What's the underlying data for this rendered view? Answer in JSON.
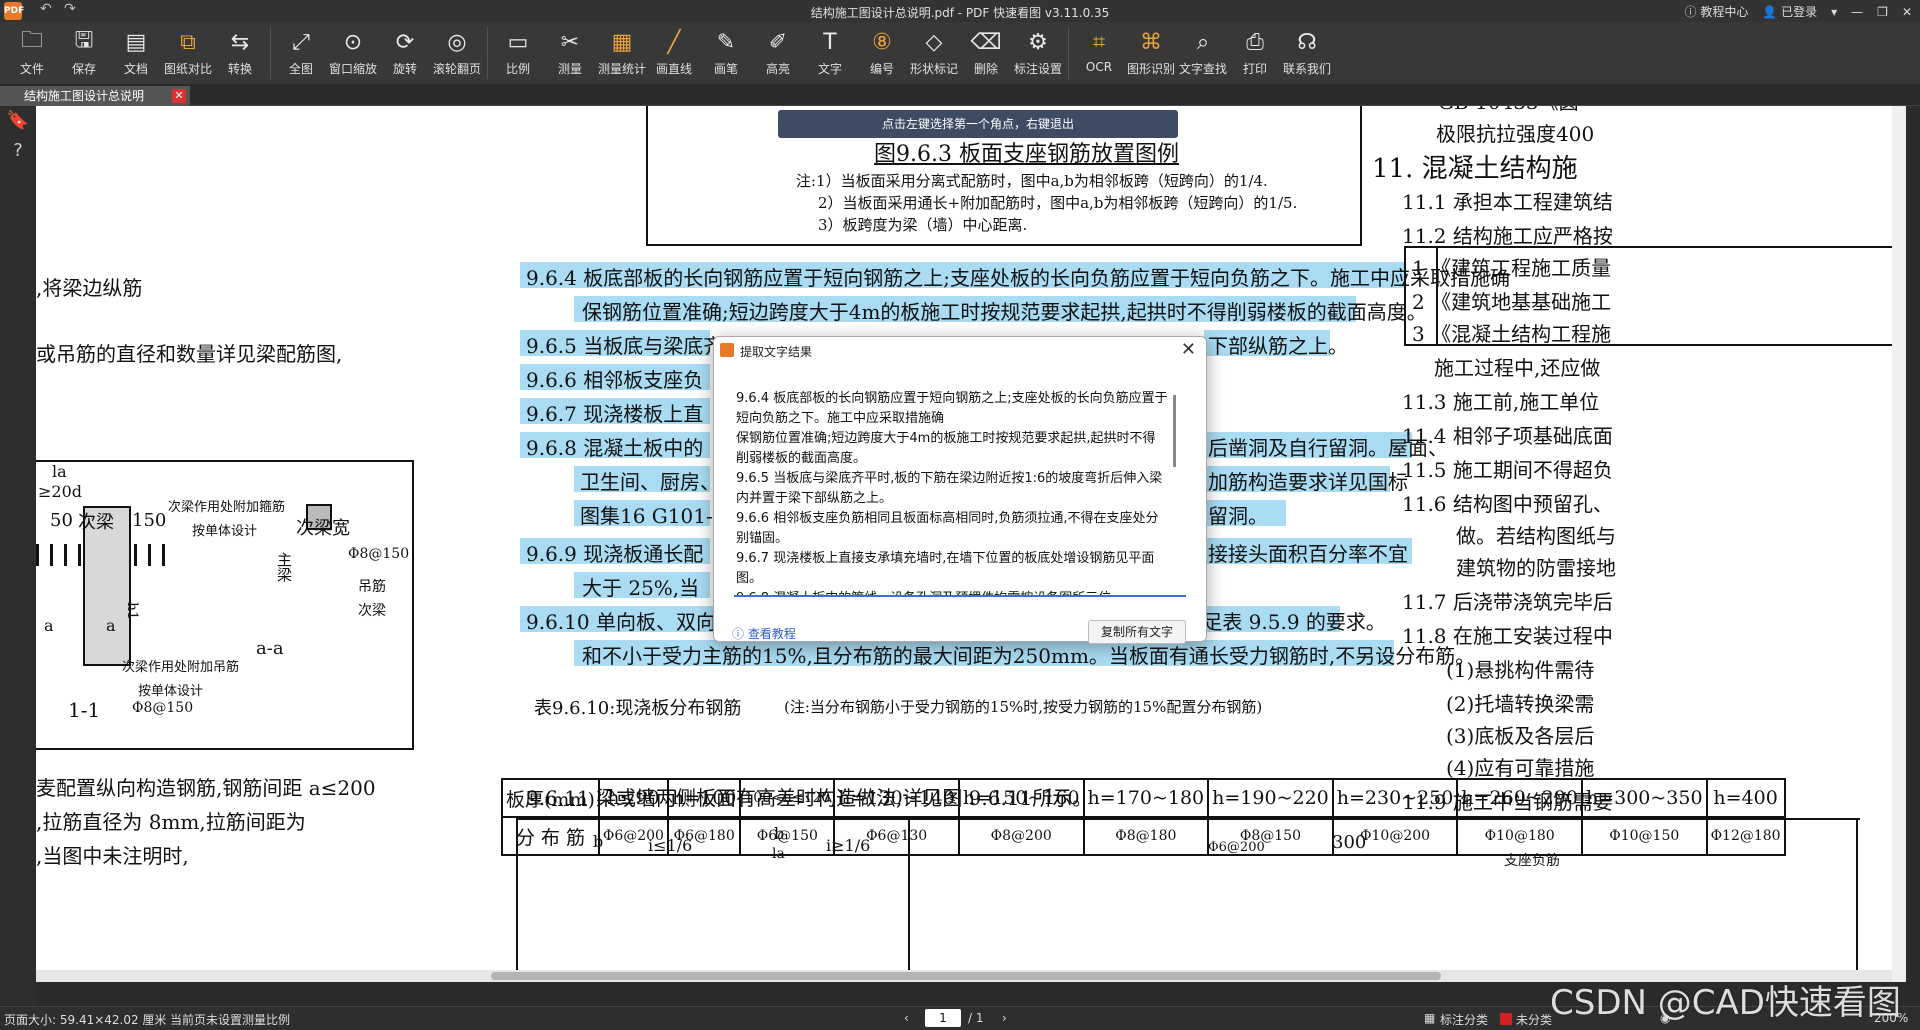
{
  "titlebar": {
    "logo": "PDF",
    "title": "结构施工图设计总说明.pdf - PDF 快速看图 v3.11.0.35",
    "help": "教程中心",
    "login": "已登录"
  },
  "toolbar": {
    "items": [
      {
        "label": "文件",
        "icon": "folder-icon",
        "glyph": "🗀"
      },
      {
        "label": "保存",
        "icon": "save-icon",
        "glyph": "🖫"
      },
      {
        "label": "文档",
        "icon": "document-icon",
        "glyph": "▤"
      },
      {
        "label": "图纸对比",
        "icon": "compare-icon",
        "glyph": "⧉"
      },
      {
        "label": "转换",
        "icon": "convert-icon",
        "glyph": "⇆"
      },
      {
        "label": "全图",
        "icon": "fit-all-icon",
        "glyph": "⤢"
      },
      {
        "label": "窗口缩放",
        "icon": "zoom-window-icon",
        "glyph": "⊙"
      },
      {
        "label": "旋转",
        "icon": "rotate-icon",
        "glyph": "⟳"
      },
      {
        "label": "滚轮翻页",
        "icon": "mouse-wheel-icon",
        "glyph": "◎"
      },
      {
        "label": "比例",
        "icon": "scale-icon",
        "glyph": "▭"
      },
      {
        "label": "测量",
        "icon": "measure-icon",
        "glyph": "✂"
      },
      {
        "label": "测量统计",
        "icon": "measure-stats-icon",
        "glyph": "▦"
      },
      {
        "label": "画直线",
        "icon": "line-icon",
        "glyph": "╱"
      },
      {
        "label": "画笔",
        "icon": "pen-icon",
        "glyph": "✎"
      },
      {
        "label": "高亮",
        "icon": "highlight-icon",
        "glyph": "✐"
      },
      {
        "label": "文字",
        "icon": "text-icon",
        "glyph": "T"
      },
      {
        "label": "编号",
        "icon": "number-icon",
        "glyph": "⑧"
      },
      {
        "label": "形状标记",
        "icon": "shape-mark-icon",
        "glyph": "◇"
      },
      {
        "label": "删除",
        "icon": "eraser-icon",
        "glyph": "⌫"
      },
      {
        "label": "标注设置",
        "icon": "annotation-settings-icon",
        "glyph": "⚙"
      },
      {
        "label": "OCR",
        "icon": "ocr-icon",
        "glyph": "⌗"
      },
      {
        "label": "图形识别",
        "icon": "shape-recognize-icon",
        "glyph": "⌘"
      },
      {
        "label": "文字查找",
        "icon": "search-icon",
        "glyph": "⌕"
      },
      {
        "label": "打印",
        "icon": "printer-icon",
        "glyph": "⎙"
      },
      {
        "label": "联系我们",
        "icon": "headset-icon",
        "glyph": "☊"
      }
    ]
  },
  "tab": {
    "label": "结构施工图设计总说明",
    "close": "✕"
  },
  "hint": "点击左键选择第一个角点，右键退出",
  "doc": {
    "fig_title": "图9.6.3  板面支座钢筋放置图例",
    "notes": [
      "注:1）当板面采用分离式配筋时，图中a,b为相邻板跨（短跨向）的1/4.",
      "2）当板面采用通长+附加配筋时，图中a,b为相邻板跨（短跨向）的1/5.",
      "3）板跨度为梁（墙）中心距离."
    ],
    "p964a": "9.6.4  板底部板的长向钢筋应置于短向钢筋之上;支座处板的长向负筋应置于短向负筋之下。施工中应采取措施确",
    "p964b": "保钢筋位置准确;短边跨度大于4m的板施工时按规范要求起拱,起拱时不得削弱楼板的截面高度。",
    "p965": "9.6.5  当板底与梁底齐",
    "p965r": "下部纵筋之上。",
    "p966": "9.6.6  相邻板支座负",
    "p967": "9.6.7  现浇楼板上直",
    "p968": "9.6.8  混凝土板中的",
    "p968r": "后凿洞及自行留洞。屋面、",
    "p968b": "卫生间、厨房、",
    "p968br": "加筋构造要求详见国标",
    "p968c": "图集16 G101-1",
    "p968cr": "留洞。",
    "p969": "9.6.9  现浇板通长配",
    "p969r": "接接头面积百分率不宜",
    "p969b": "大于 25%,当",
    "p9610a": "9.6.10  单向板、双向板支座负筋的分布筋,除平面图中另有注明者外应同时满足表 9.5.9 的要求。",
    "p9610b": "和不小于受力主筋的15%,且分布筋的最大间距为250mm。当板面有通长受力钢筋时,不另设分布筋。",
    "table_caption": "表9.6.10:现浇板分布钢筋",
    "table_note": "(注:当分布钢筋小于受力钢筋的15%时,按受力钢筋的15%配置分布钢筋)",
    "table_head": [
      "板厚(mm)",
      "h≤90",
      "h=100",
      "100<h≤120",
      "h=130~140",
      "h=150~160",
      "h=170~180",
      "h=190~220",
      "h=230~250",
      "h=260~290",
      "h=300~350",
      "h=400"
    ],
    "table_row": [
      "分 布 筋",
      "Φ6@200",
      "Φ6@180",
      "Φ6@150",
      "Φ6@130",
      "Φ8@200",
      "Φ8@180",
      "Φ8@150",
      "Φ10@200",
      "Φ10@180",
      "Φ10@150",
      "Φ12@180"
    ],
    "p9611": "9.6.11  梁或墙两侧板面有高差时构造做法,详见图 9.6.11所示。",
    "left_texts": [
      ",将梁边纵筋",
      "或吊筋的直径和数量详见梁配筋图,",
      "麦配置纵向构造钢筋,钢筋间距  a≤200",
      ",拉筋直径为 8mm,拉筋间距为",
      ",当图中未注明时,"
    ],
    "left_fig": {
      "la": "la",
      "ge20d": "≥20d",
      "dist": "50",
      "sec_beam": "次梁",
      "d150": "150",
      "addl_hoop": "次梁作用处附加箍筋",
      "by_design": "按单体设计",
      "sec_width": "次梁宽",
      "main_beam": "主梁",
      "stirrup": "Φ8@150",
      "hanger": "吊筋",
      "sec_beam2": "次梁",
      "a1": "a",
      "a2": "a",
      "h1": "h1",
      "addl_hanger": "次梁作用处附加吊筋",
      "by_design2": "按单体设计",
      "aa": "a-a",
      "sec11": "1-1",
      "stirrup2": "Φ8@150"
    },
    "right_texts": [
      "GB 10433《圆",
      "极限抗拉强度400",
      "11. 混凝土结构施",
      "11.1  承担本工程建筑结",
      "11.2  结构施工应严格按",
      "1  《建筑工程施工质量",
      "2  《建筑地基基础施工",
      "3  《混凝土结构工程施",
      "施工过程中,还应做",
      "11.3  施工前,施工单位",
      "11.4  相邻子项基础底面",
      "11.5  施工期间不得超负",
      "11.6  结构图中预留孔、",
      "做。若结构图纸与",
      "建筑物的防雷接地",
      "11.7  后浇带浇筑完毕后",
      "11.8  在施工安装过程中",
      "(1)悬挑构件需待",
      "(2)托墙转换梁需",
      "(3)底板及各层后",
      "(4)应有可靠措施",
      "11.9  施工中当钢筋需要"
    ],
    "bottom_fig": {
      "b1": "b",
      "i1": "i≤1/6",
      "b2": "b",
      "la": "la",
      "i2": "i≥1/6",
      "d200": "Φ6@200",
      "n300": "300",
      "support": "支座负筋"
    }
  },
  "dialog": {
    "title": "提取文字结果",
    "lines": [
      "9.6.4 板底部板的长向钢筋应置于短向钢筋之上;支座处板的长向负筋应置于短向负筋之下。施工中应采取措施确",
      "保钢筋位置准确;短边跨度大于4m的板施工时按规范要求起拱,起拱时不得削弱楼板的截面高度。",
      "9.6.5 当板底与梁底齐平时,板的下筋在梁边附近按1:6的坡度弯折后伸入梁内并置于梁下部纵筋之上。",
      "9.6.6 相邻板支座负筋相同且板面标高相同时,负筋须拉通,不得在支座处分别锚固。",
      "9.6.7 现浇楼板上直接支承填充墙时,在墙下位置的板底处增设钢筋见平面图。",
      "9.6.8 混凝土板中的管线、设备孔洞及预埋件均需按设备图所示位"
    ],
    "tutorial": "查看教程",
    "copy": "复制所有文字"
  },
  "statusbar": {
    "page_size": "页面大小: 59.41×42.02 厘米",
    "scale_note": "当前页未设置测量比例",
    "page": "1",
    "total": "/ 1",
    "annot_class": "标注分类",
    "unclassified": "未分类",
    "zoom": "200%"
  },
  "watermark": "CSDN @CAD快速看图"
}
